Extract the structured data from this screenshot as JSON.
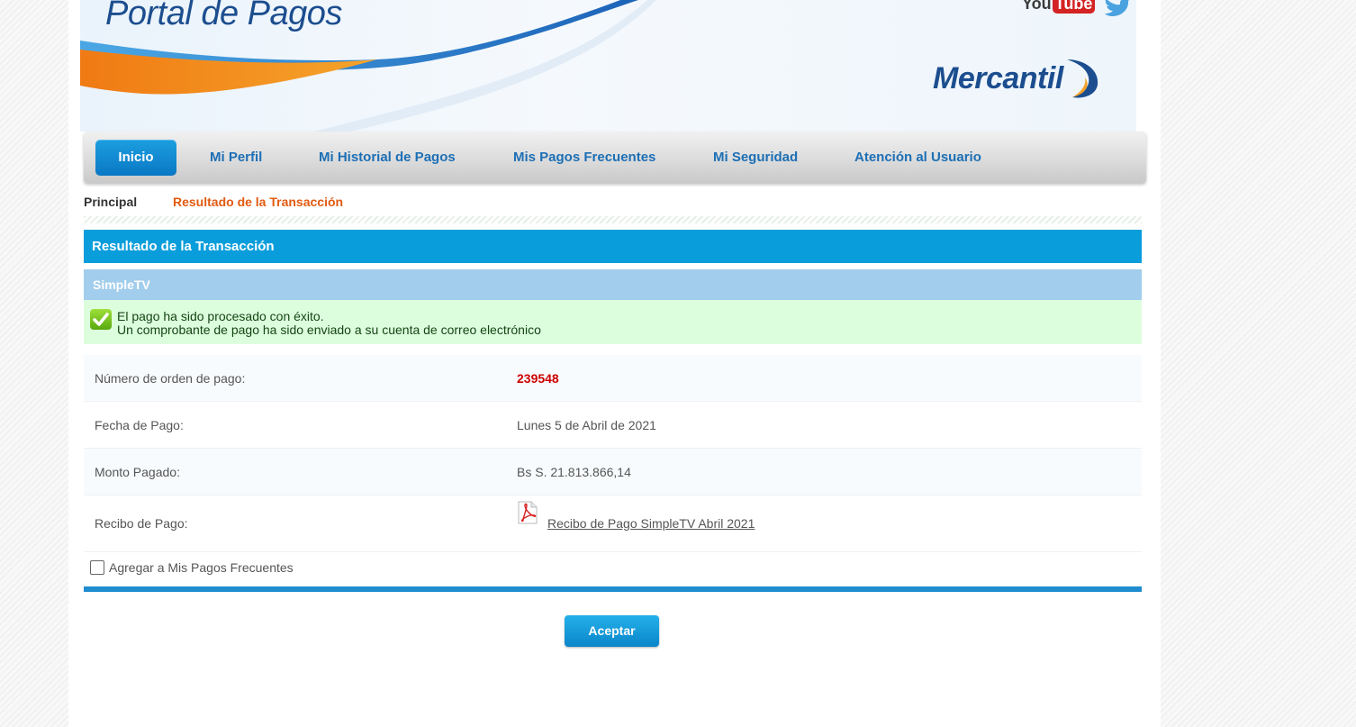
{
  "header": {
    "title": "Portal de Pagos",
    "brand": "Mercantil",
    "social": {
      "youtube_you": "You",
      "youtube_tube": "Tube"
    }
  },
  "nav": {
    "items": [
      {
        "label": "Inicio"
      },
      {
        "label": "Mi Perfil"
      },
      {
        "label": "Mi Historial de Pagos"
      },
      {
        "label": "Mis Pagos Frecuentes"
      },
      {
        "label": "Mi Seguridad"
      },
      {
        "label": "Atención al Usuario"
      }
    ],
    "active": "Inicio"
  },
  "breadcrumb": {
    "home": "Principal",
    "current": "Resultado de la Transacción"
  },
  "result": {
    "section_title": "Resultado de la Transacción",
    "provider": "SimpleTV",
    "success_line1": "El pago ha sido procesado con éxito.",
    "success_line2": "Un comprobante de pago ha sido enviado a su cuenta de correo electrónico",
    "rows": [
      {
        "label": "Número de orden de pago:",
        "value": "239548"
      },
      {
        "label": "Fecha de Pago:",
        "value": "Lunes 5 de Abril de 2021"
      },
      {
        "label": "Monto Pagado:",
        "value": "Bs S. 21.813.866,14"
      },
      {
        "label": "Recibo de Pago:",
        "value": "Recibo de Pago SimpleTV Abril 2021"
      }
    ],
    "favorite_label": "Agregar a Mis Pagos Frecuentes",
    "favorite_checked": false,
    "accept_label": "Aceptar"
  },
  "colors": {
    "primary_blue": "#0a9ddb",
    "nav_text": "#1d6fb5",
    "breadcrumb_current": "#e25a10",
    "order_number": "#cc0000",
    "success_bg": "#ddfedd"
  },
  "icons": [
    "youtube-icon",
    "twitter-icon",
    "mercantil-logo-icon",
    "check-icon",
    "pdf-icon"
  ]
}
